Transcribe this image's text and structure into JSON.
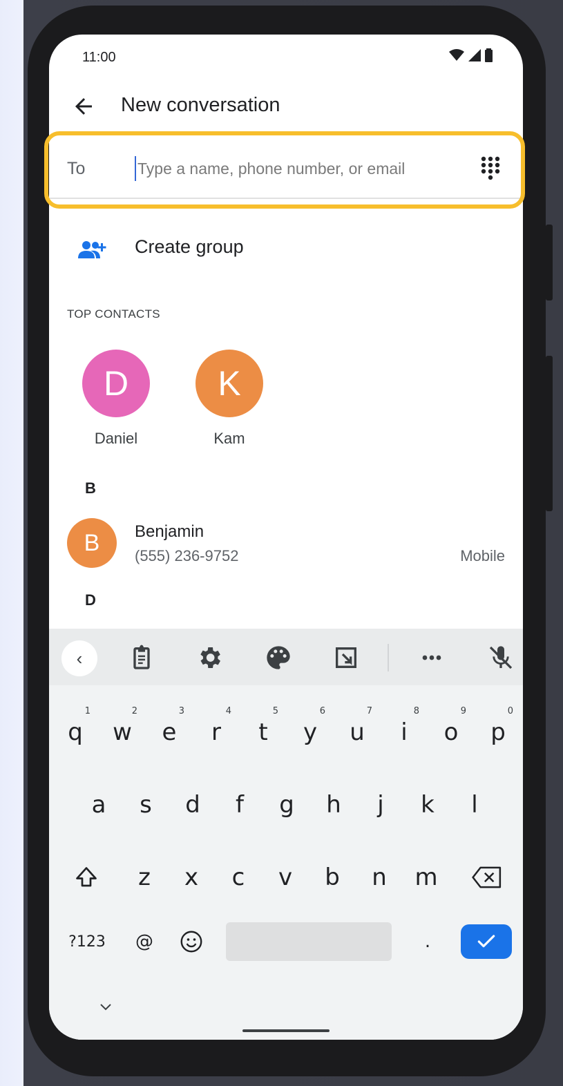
{
  "status_bar": {
    "time": "11:00"
  },
  "app_bar": {
    "title": "New conversation"
  },
  "to_field": {
    "label": "To",
    "placeholder": "Type a name, phone number, or email"
  },
  "create_group": {
    "label": "Create group"
  },
  "top_contacts": {
    "header": "TOP CONTACTS",
    "contacts": [
      {
        "initial": "D",
        "name": "Daniel",
        "color": "#e667b8"
      },
      {
        "initial": "K",
        "name": "Kam",
        "color": "#ec8d45"
      }
    ]
  },
  "contact_list": {
    "sections": [
      {
        "letter": "B",
        "contacts": [
          {
            "initial": "B",
            "name": "Benjamin",
            "phone": "(555) 236-9752",
            "type": "Mobile",
            "color": "#ec8d45"
          }
        ]
      },
      {
        "letter": "D",
        "contacts": []
      }
    ]
  },
  "keyboard": {
    "row1": [
      "q",
      "w",
      "e",
      "r",
      "t",
      "y",
      "u",
      "i",
      "o",
      "p"
    ],
    "row1_hints": [
      "1",
      "2",
      "3",
      "4",
      "5",
      "6",
      "7",
      "8",
      "9",
      "0"
    ],
    "row2": [
      "a",
      "s",
      "d",
      "f",
      "g",
      "h",
      "j",
      "k",
      "l"
    ],
    "row3": [
      "z",
      "x",
      "c",
      "v",
      "b",
      "n",
      "m"
    ],
    "symbols_key": "?123",
    "at_key": "@",
    "period_key": ".",
    "toolbar_icons": [
      "chevron-left-icon",
      "clipboard-icon",
      "gear-icon",
      "palette-icon",
      "floating-keyboard-icon",
      "more-icon",
      "mic-off-icon"
    ]
  },
  "colors": {
    "highlight": "#f7be2c",
    "accent": "#1a73e8"
  }
}
